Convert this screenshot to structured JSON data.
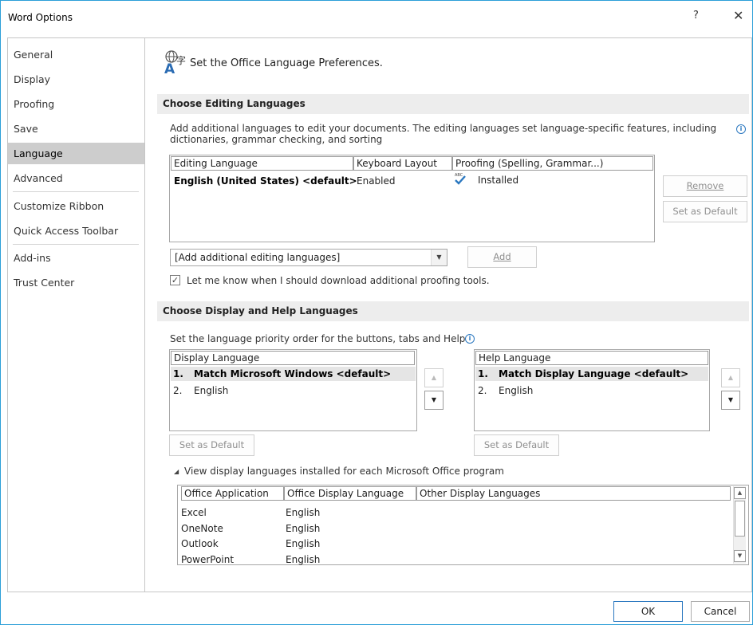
{
  "window": {
    "title": "Word Options",
    "help_glyph": "?",
    "close_glyph": "✕"
  },
  "sidebar": {
    "items": [
      {
        "label": "General"
      },
      {
        "label": "Display"
      },
      {
        "label": "Proofing"
      },
      {
        "label": "Save"
      },
      {
        "label": "Language",
        "selected": true
      },
      {
        "label": "Advanced"
      },
      {
        "label": "Customize Ribbon"
      },
      {
        "label": "Quick Access Toolbar"
      },
      {
        "label": "Add-ins"
      },
      {
        "label": "Trust Center"
      }
    ]
  },
  "header": {
    "icon": "language-preferences-icon",
    "text": "Set the Office Language Preferences."
  },
  "editing": {
    "section_title": "Choose Editing Languages",
    "description_line1": "Add additional languages to edit your documents. The editing languages set language-specific features, including",
    "description_line2": "dictionaries, grammar checking, and sorting",
    "columns": [
      "Editing Language",
      "Keyboard Layout",
      "Proofing (Spelling, Grammar...)"
    ],
    "rows": [
      {
        "language": "English (United States) <default>",
        "keyboard": "Enabled",
        "proofing": "Installed",
        "proofing_icon_text": "ABC"
      }
    ],
    "remove_button": "Remove",
    "set_default_button": "Set as Default",
    "add_combo_value": "[Add additional editing languages]",
    "add_button": "Add",
    "notify_checkbox_label": "Let me know when I should download additional proofing tools.",
    "notify_checked": true
  },
  "display": {
    "section_title": "Choose Display and Help Languages",
    "description": "Set the language priority order for the buttons, tabs and Help",
    "display_list": {
      "header": "Display Language",
      "items": [
        {
          "num": "1.",
          "label": "Match Microsoft Windows <default>"
        },
        {
          "num": "2.",
          "label": "English"
        }
      ]
    },
    "help_list": {
      "header": "Help Language",
      "items": [
        {
          "num": "1.",
          "label": "Match Display Language <default>"
        },
        {
          "num": "2.",
          "label": "English"
        }
      ]
    },
    "set_default_display": "Set as Default",
    "set_default_help": "Set as Default",
    "view_installed_label": "View display languages installed for each Microsoft Office program",
    "installed_table": {
      "columns": [
        "Office Application",
        "Office Display Language",
        "Other Display Languages"
      ],
      "rows": [
        {
          "app": "Excel",
          "language": "English",
          "other": ""
        },
        {
          "app": "OneNote",
          "language": "English",
          "other": ""
        },
        {
          "app": "Outlook",
          "language": "English",
          "other": ""
        },
        {
          "app": "PowerPoint",
          "language": "English",
          "other": ""
        }
      ]
    }
  },
  "footer": {
    "ok": "OK",
    "cancel": "Cancel"
  },
  "colors": {
    "window_border": "#2b9fd8",
    "selected_nav": "#cdcdcd",
    "section_bar": "#ededed",
    "info_blue": "#2b78c0"
  }
}
